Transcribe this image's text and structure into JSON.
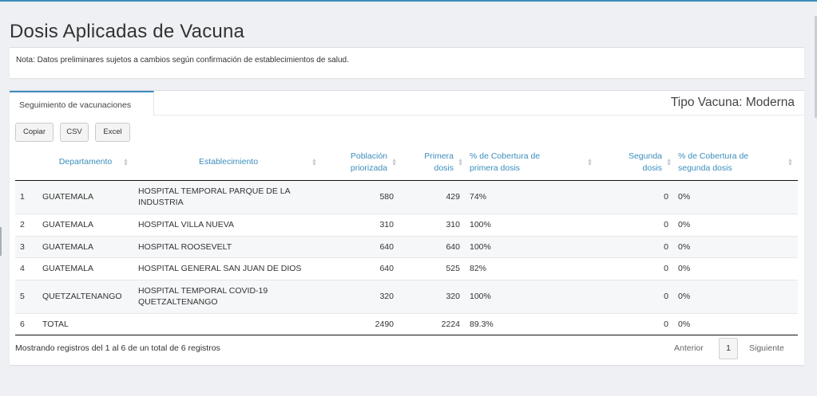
{
  "page": {
    "title": "Dosis Aplicadas de Vacuna",
    "note": "Nota: Datos preliminares sujetos a cambios según confirmación de establecimientos de salud.",
    "accent_color": "#3c8dbc"
  },
  "card": {
    "tab_label": "Seguimiento de vacunaciones",
    "tipo_vacuna": "Tipo Vacuna: Moderna"
  },
  "buttons": {
    "copy": "Copiar",
    "csv": "CSV",
    "excel": "Excel"
  },
  "table": {
    "headers": {
      "departamento": "Departamento",
      "establecimiento": "Establecimiento",
      "poblacion_1": "Población",
      "poblacion_2": "priorizada",
      "primera_1": "Primera",
      "primera_2": "dosis",
      "cob_primera_1": "% de Cobertura de",
      "cob_primera_2": "primera dosis",
      "segunda_1": "Segunda",
      "segunda_2": "dosis",
      "cob_segunda_1": "% de Cobertura de",
      "cob_segunda_2": "segunda dosis"
    },
    "rows": [
      {
        "idx": "1",
        "departamento": "GUATEMALA",
        "establecimiento_1": "HOSPITAL TEMPORAL PARQUE DE LA",
        "establecimiento_2": "INDUSTRIA",
        "poblacion": "580",
        "primera": "429",
        "cob_primera": "74%",
        "segunda": "0",
        "cob_segunda": "0%"
      },
      {
        "idx": "2",
        "departamento": "GUATEMALA",
        "establecimiento_1": "HOSPITAL VILLA NUEVA",
        "establecimiento_2": "",
        "poblacion": "310",
        "primera": "310",
        "cob_primera": "100%",
        "segunda": "0",
        "cob_segunda": "0%"
      },
      {
        "idx": "3",
        "departamento": "GUATEMALA",
        "establecimiento_1": "HOSPITAL ROOSEVELT",
        "establecimiento_2": "",
        "poblacion": "640",
        "primera": "640",
        "cob_primera": "100%",
        "segunda": "0",
        "cob_segunda": "0%"
      },
      {
        "idx": "4",
        "departamento": "GUATEMALA",
        "establecimiento_1": "HOSPITAL GENERAL SAN JUAN DE DIOS",
        "establecimiento_2": "",
        "poblacion": "640",
        "primera": "525",
        "cob_primera": "82%",
        "segunda": "0",
        "cob_segunda": "0%"
      },
      {
        "idx": "5",
        "departamento": "QUETZALTENANGO",
        "establecimiento_1": "HOSPITAL TEMPORAL COVID-19",
        "establecimiento_2": "QUETZALTENANGO",
        "poblacion": "320",
        "primera": "320",
        "cob_primera": "100%",
        "segunda": "0",
        "cob_segunda": "0%"
      },
      {
        "idx": "6",
        "departamento": "TOTAL",
        "establecimiento_1": "",
        "establecimiento_2": "",
        "poblacion": "2490",
        "primera": "2224",
        "cob_primera": "89.3%",
        "segunda": "0",
        "cob_segunda": "0%"
      }
    ]
  },
  "footer": {
    "info": "Mostrando registros del 1 al 6 de un total de 6 registros",
    "prev": "Anterior",
    "page": "1",
    "next": "Siguiente"
  }
}
